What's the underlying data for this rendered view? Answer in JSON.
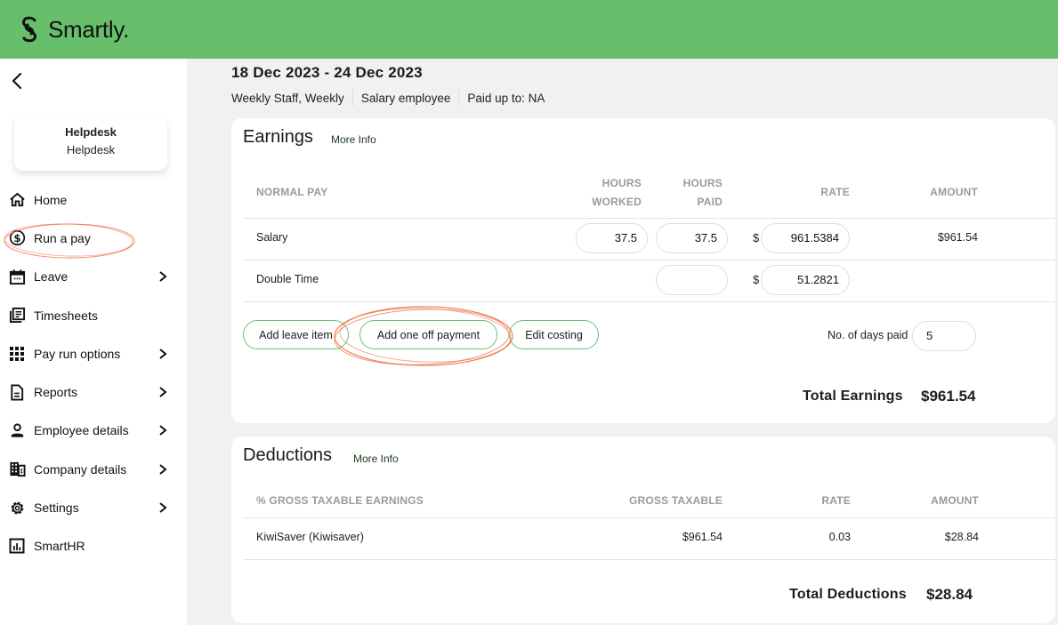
{
  "brand": {
    "name": "Smartly.",
    "header_color": "#68bf6b",
    "accent_color": "#6cbf78",
    "annotation_color": "#ee6b3c"
  },
  "user": {
    "name": "Helpdesk",
    "role": "Helpdesk"
  },
  "nav": {
    "back_icon": "chevron-left-icon",
    "items": [
      {
        "label": "Home",
        "icon": "home-icon",
        "has_submenu": false
      },
      {
        "label": "Run a pay",
        "icon": "dollar-circle-icon",
        "has_submenu": false,
        "annotated": true
      },
      {
        "label": "Leave",
        "icon": "calendar-icon",
        "has_submenu": true
      },
      {
        "label": "Timesheets",
        "icon": "timesheets-icon",
        "has_submenu": false
      },
      {
        "label": "Pay run options",
        "icon": "grid-icon",
        "has_submenu": true
      },
      {
        "label": "Reports",
        "icon": "document-icon",
        "has_submenu": true
      },
      {
        "label": "Employee details",
        "icon": "person-icon",
        "has_submenu": true
      },
      {
        "label": "Company details",
        "icon": "building-icon",
        "has_submenu": true
      },
      {
        "label": "Settings",
        "icon": "gear-icon",
        "has_submenu": true
      },
      {
        "label": "SmartHR",
        "icon": "bar-chart-icon",
        "has_submenu": false
      }
    ]
  },
  "pay_period": {
    "range": "18 Dec 2023 - 24 Dec 2023",
    "meta": [
      "Weekly Staff, Weekly",
      "Salary employee",
      "Paid up to: NA"
    ]
  },
  "earnings": {
    "title": "Earnings",
    "more_info": "More Info",
    "columns": {
      "name": "NORMAL PAY",
      "hours_worked_1": "HOURS",
      "hours_worked_2": "WORKED",
      "hours_paid_1": "HOURS",
      "hours_paid_2": "PAID",
      "rate": "RATE",
      "amount": "AMOUNT"
    },
    "rows": [
      {
        "name": "Salary",
        "hours_worked": "37.5",
        "hours_paid": "37.5",
        "currency": "$",
        "rate": "961.5384",
        "amount": "$961.54"
      },
      {
        "name": "Double Time",
        "hours_worked": null,
        "hours_paid": "",
        "currency": "$",
        "rate": "51.2821",
        "amount": ""
      }
    ],
    "buttons": {
      "add_leave_item": "Add leave item",
      "add_one_off_payment": "Add one off payment",
      "edit_costing": "Edit costing"
    },
    "days_paid_label": "No. of days paid",
    "days_paid_value": "5",
    "total_label": "Total Earnings",
    "total_value": "$961.54"
  },
  "deductions": {
    "title": "Deductions",
    "more_info": "More Info",
    "columns": {
      "name": "% GROSS TAXABLE EARNINGS",
      "gross_taxable": "GROSS TAXABLE",
      "rate": "RATE",
      "amount": "AMOUNT"
    },
    "rows": [
      {
        "name": "KiwiSaver (Kiwisaver)",
        "gross_taxable": "$961.54",
        "rate": "0.03",
        "amount": "$28.84"
      }
    ],
    "total_label": "Total Deductions",
    "total_value": "$28.84"
  }
}
